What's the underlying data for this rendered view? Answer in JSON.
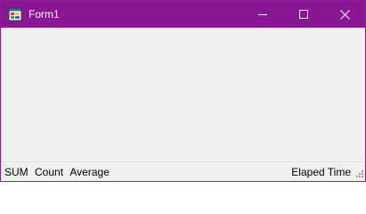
{
  "window": {
    "title": "Form1",
    "icons": {
      "app": "form-app-icon",
      "minimize": "minimize-icon",
      "maximize": "maximize-icon",
      "close": "close-icon",
      "grip": "resize-grip-icon"
    },
    "colors": {
      "titlebar": "#8b1695",
      "border": "#8b1e96",
      "client": "#f0f0f0"
    }
  },
  "statusbar": {
    "sum_label": "SUM",
    "count_label": "Count",
    "average_label": "Average",
    "elapsed_label": "Elaped Time"
  }
}
